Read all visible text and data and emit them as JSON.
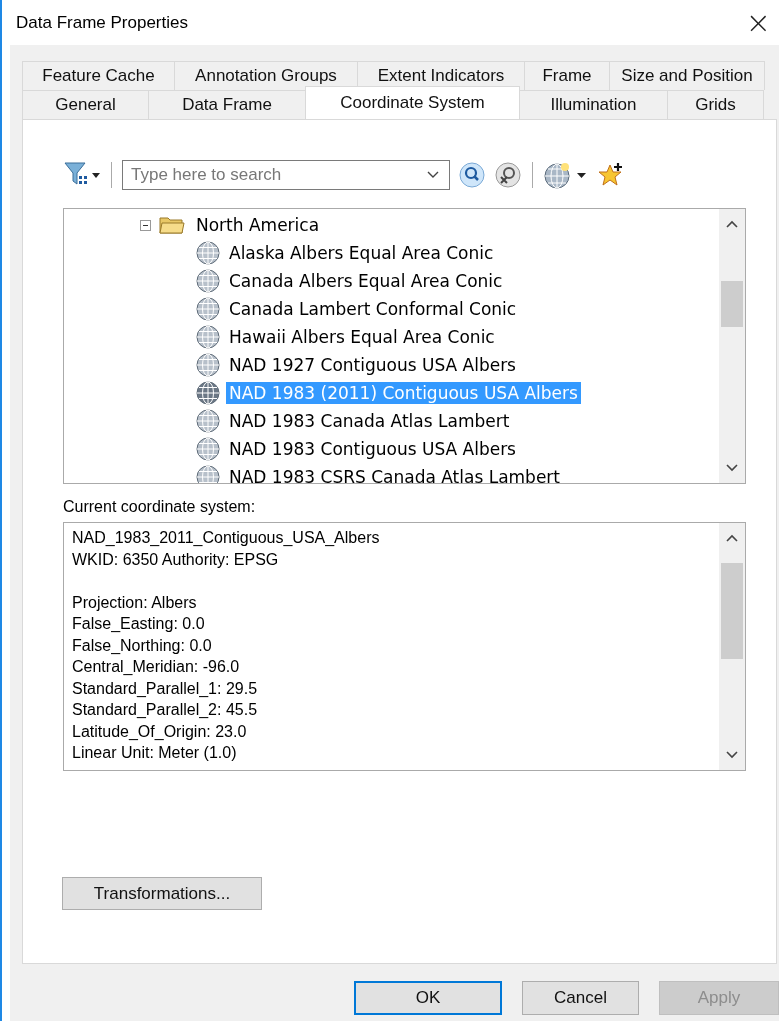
{
  "window": {
    "title": "Data Frame Properties",
    "close": "×"
  },
  "tab_rows": [
    [
      {
        "label": "Feature Cache",
        "selected": false
      },
      {
        "label": "Annotation Groups",
        "selected": false
      },
      {
        "label": "Extent Indicators",
        "selected": false
      },
      {
        "label": "Frame",
        "selected": false
      },
      {
        "label": "Size and Position",
        "selected": false
      }
    ],
    [
      {
        "label": "General",
        "selected": false
      },
      {
        "label": "Data Frame",
        "selected": false
      },
      {
        "label": "Coordinate System",
        "selected": true
      },
      {
        "label": "Illumination",
        "selected": false
      },
      {
        "label": "Grids",
        "selected": false
      }
    ]
  ],
  "search": {
    "placeholder": "Type here to search"
  },
  "tree": [
    {
      "label": "North America",
      "kind": "folder",
      "expanded": true,
      "children": [
        {
          "label": "Alaska Albers Equal Area Conic",
          "kind": "projection",
          "selected": false
        },
        {
          "label": "Canada Albers Equal Area Conic",
          "kind": "projection",
          "selected": false
        },
        {
          "label": "Canada Lambert Conformal Conic",
          "kind": "projection",
          "selected": false
        },
        {
          "label": "Hawaii Albers Equal Area Conic",
          "kind": "projection",
          "selected": false
        },
        {
          "label": "NAD 1927 Contiguous USA Albers",
          "kind": "projection",
          "selected": false
        },
        {
          "label": "NAD 1983 (2011) Contiguous USA Albers",
          "kind": "projection",
          "selected": true
        },
        {
          "label": "NAD 1983 Canada Atlas Lambert",
          "kind": "projection",
          "selected": false
        },
        {
          "label": "NAD 1983 Contiguous USA Albers",
          "kind": "projection",
          "selected": false
        },
        {
          "label": "NAD 1983 CSRS Canada Atlas Lambert",
          "kind": "projection",
          "selected": false
        }
      ]
    }
  ],
  "current_label": "Current coordinate system:",
  "current_blocks": [
    [
      "NAD_1983_2011_Contiguous_USA_Albers",
      "WKID: 6350 Authority: EPSG"
    ],
    [
      "Projection: Albers",
      "False_Easting: 0.0",
      "False_Northing: 0.0",
      "Central_Meridian: -96.0",
      "Standard_Parallel_1: 29.5",
      "Standard_Parallel_2: 45.5",
      "Latitude_Of_Origin: 23.0",
      "Linear Unit: Meter (1.0)"
    ]
  ],
  "transformations_button": "Transformations...",
  "buttons": [
    {
      "label": "OK",
      "kind": "default",
      "disabled": false
    },
    {
      "label": "Cancel",
      "kind": "normal",
      "disabled": false
    },
    {
      "label": "Apply",
      "kind": "normal",
      "disabled": true
    }
  ]
}
